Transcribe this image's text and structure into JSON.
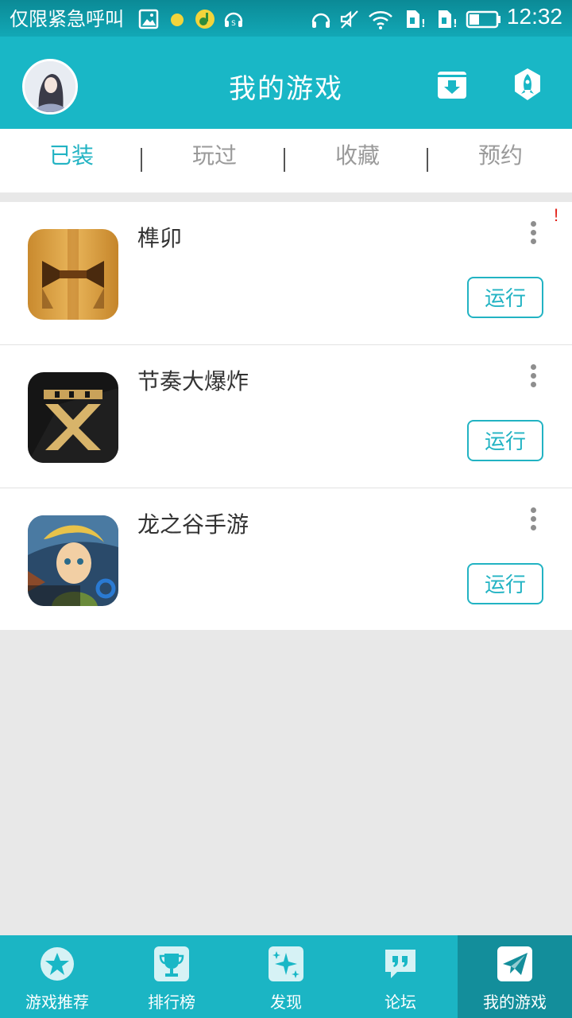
{
  "status": {
    "carrier": "仅限紧急呼叫",
    "time": "12:32"
  },
  "header": {
    "title": "我的游戏"
  },
  "tabs": [
    {
      "label": "已装",
      "active": true
    },
    {
      "label": "玩过",
      "active": false
    },
    {
      "label": "收藏",
      "active": false
    },
    {
      "label": "预约",
      "active": false
    }
  ],
  "games": [
    {
      "name": "榫卯",
      "action": "运行",
      "alert": "!"
    },
    {
      "name": "节奏大爆炸",
      "action": "运行"
    },
    {
      "name": "龙之谷手游",
      "action": "运行"
    }
  ],
  "nav": [
    {
      "label": "游戏推荐",
      "icon": "star-icon"
    },
    {
      "label": "排行榜",
      "icon": "trophy-icon"
    },
    {
      "label": "发现",
      "icon": "sparkle-icon"
    },
    {
      "label": "论坛",
      "icon": "quote-bubble-icon"
    },
    {
      "label": "我的游戏",
      "icon": "paper-plane-icon",
      "active": true
    }
  ],
  "colors": {
    "accent": "#19b7c6",
    "accent_dark": "#138e9b",
    "alert": "#e2231a"
  }
}
